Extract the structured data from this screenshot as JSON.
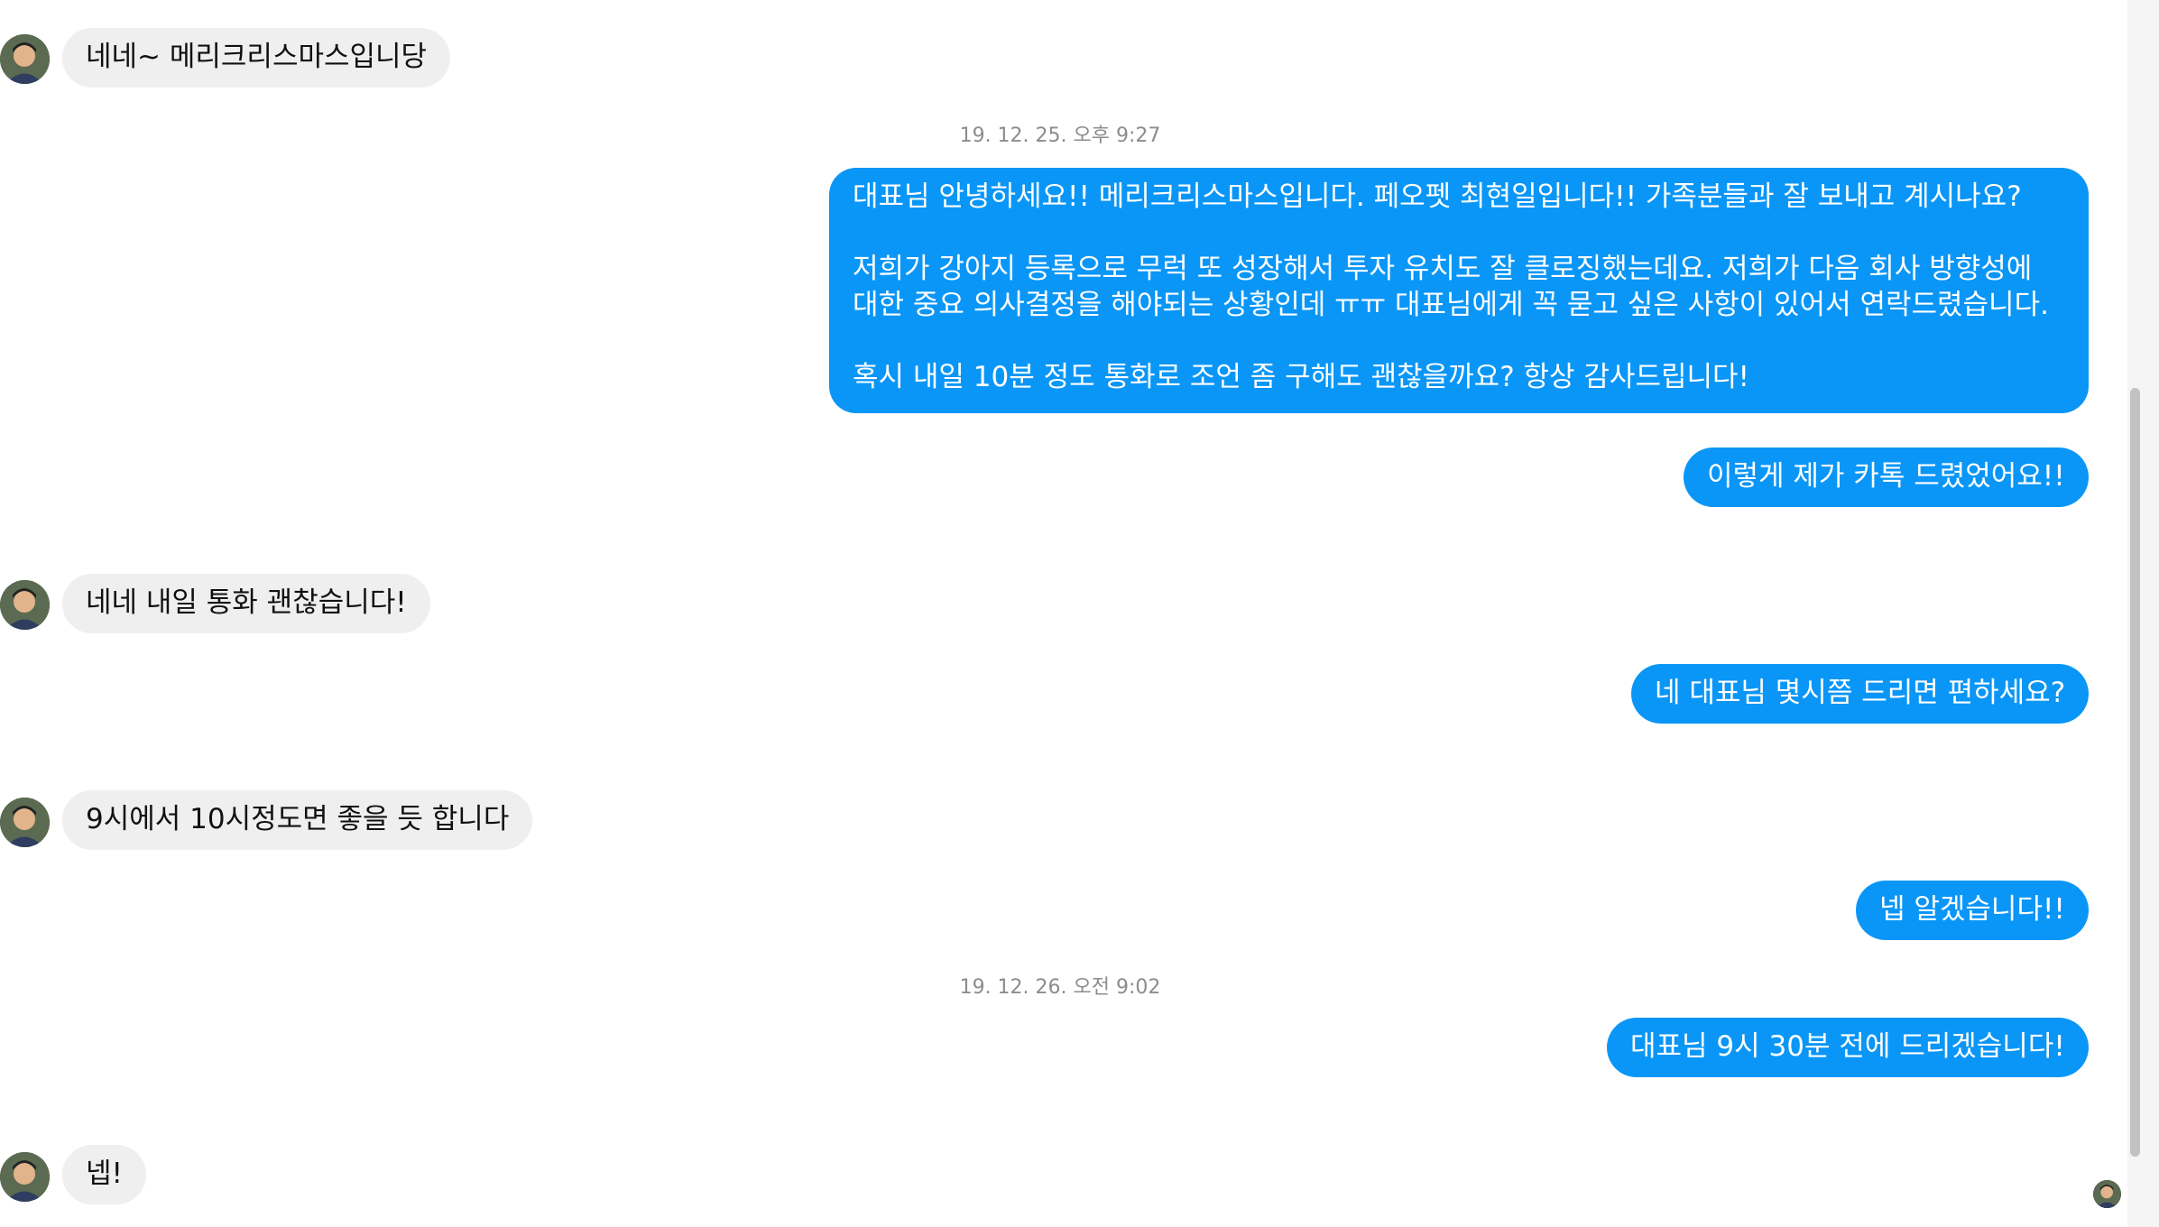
{
  "conversation": {
    "messages": [
      {
        "id": "m1",
        "direction": "incoming",
        "text": "네네~ 메리크리스마스입니당"
      },
      {
        "id": "m2",
        "direction": "outgoing",
        "text": "대표님 안녕하세요!! 메리크리스마스입니다. 페오펫 최현일입니다!! 가족분들과 잘 보내고 계시나요?\n\n저희가 강아지 등록으로 무럭 또 성장해서 투자 유치도 잘 클로징했는데요. 저희가 다음 회사 방향성에 대한 중요 의사결정을 해야되는 상황인데 ㅠㅠ 대표님에게 꼭 묻고 싶은 사항이 있어서 연락드렸습니다.\n\n혹시 내일 10분 정도 통화로 조언 좀 구해도 괜찮을까요? 항상 감사드립니다!"
      },
      {
        "id": "m3",
        "direction": "outgoing",
        "text": "이렇게 제가 카톡 드렸었어요!!"
      },
      {
        "id": "m4",
        "direction": "incoming",
        "text": "네네 내일 통화 괜찮습니다!"
      },
      {
        "id": "m5",
        "direction": "outgoing",
        "text": "네 대표님 몇시쯤 드리면 편하세요?"
      },
      {
        "id": "m6",
        "direction": "incoming",
        "text": "9시에서 10시정도면 좋을 듯 합니다"
      },
      {
        "id": "m7",
        "direction": "outgoing",
        "text": "넵 알겠습니다!!"
      },
      {
        "id": "m8",
        "direction": "outgoing",
        "text": "대표님 9시 30분 전에 드리겠습니다!"
      },
      {
        "id": "m9",
        "direction": "incoming",
        "text": "넵!"
      }
    ],
    "timestamps": {
      "t1": "19. 12. 25. 오후 9:27",
      "t2": "19. 12. 26. 오전 9:02"
    }
  },
  "colors": {
    "outgoing_bubble": "#0a96f7",
    "incoming_bubble": "#efefef",
    "timestamp_text": "#8c8c8c"
  },
  "icons": {
    "contact_avatar": "profile-photo",
    "seen_indicator": "profile-photo-small"
  }
}
